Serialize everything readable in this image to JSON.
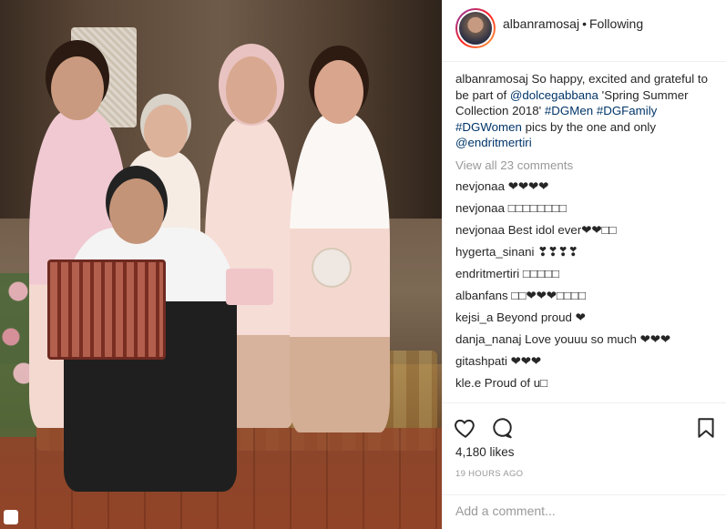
{
  "post": {
    "username": "albanramosaj",
    "follow_separator": "•",
    "follow_status": "Following"
  },
  "caption": {
    "username": "albanramosaj",
    "text_1": "So happy, excited and grateful to be part of",
    "mention_1": "@dolcegabbana",
    "text_2": "'Spring Summer Collection 2018'",
    "hashtag_1": "#DGMen",
    "hashtag_2": "#DGFamily",
    "hashtag_3": "#DGWomen",
    "text_3": "pics by the one and only",
    "mention_2": "@endritmertiri"
  },
  "view_all": "View all 23 comments",
  "comments": [
    {
      "username": "nevjonaa",
      "text": "❤❤❤❤"
    },
    {
      "username": "nevjonaa",
      "text": "□□□□□□□□"
    },
    {
      "username": "nevjonaa",
      "text": "Best idol ever❤❤□□"
    },
    {
      "username": "hygerta_sinani",
      "text": "❣❣❣❣"
    },
    {
      "username": "endritmertiri",
      "text": "□□□□□"
    },
    {
      "username": "albanfans",
      "text": "□□❤❤❤□□□□"
    },
    {
      "username": "kejsi_a",
      "text": "Beyond proud ❤"
    },
    {
      "username": "danja_nanaj",
      "text": "Love youuu so much ❤❤❤"
    },
    {
      "username": "gitashpati",
      "text": "❤❤❤"
    },
    {
      "username": "kle.e",
      "text": "Proud of u□"
    }
  ],
  "actions": {
    "like_icon": "heart-icon",
    "comment_icon": "comment-bubble-icon",
    "save_icon": "bookmark-icon"
  },
  "likes": "4,180 likes",
  "timestamp": "19 HOURS AGO",
  "comment_input": {
    "placeholder": "Add a comment...",
    "value": ""
  },
  "colors": {
    "link": "#003569",
    "muted": "#999999",
    "text": "#262626",
    "border": "#efefef"
  }
}
